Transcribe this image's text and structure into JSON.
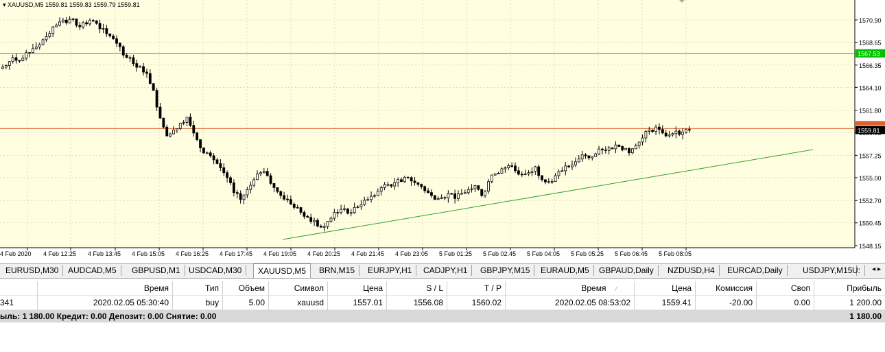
{
  "chart_header": {
    "symbol": "XAUUSD,M5",
    "ohlc": "1559.81 1559.83 1559.79 1559.81"
  },
  "price_labels": [
    "1570.90",
    "1568.65",
    "1566.35",
    "1564.10",
    "1561.80",
    "1559.55",
    "1557.25",
    "1555.00",
    "1552.70",
    "1550.45",
    "1548.15"
  ],
  "hline_green_label": "1567.53",
  "current_price_label": "1559.81",
  "time_labels": [
    "4 Feb 2020",
    "4 Feb 12:25",
    "4 Feb 13:45",
    "4 Feb 15:05",
    "4 Feb 16:25",
    "4 Feb 17:45",
    "4 Feb 19:05",
    "4 Feb 20:25",
    "4 Feb 21:45",
    "4 Feb 23:05",
    "5 Feb 01:25",
    "5 Feb 02:45",
    "5 Feb 04:05",
    "5 Feb 05:25",
    "5 Feb 06:45",
    "5 Feb 08:05"
  ],
  "colors": {
    "bg": "#fffee0",
    "grid": "#c8c8a0",
    "green_line": "#00c000",
    "trend_line": "#30a030",
    "orange_line": "#e06030",
    "candle": "#000000"
  },
  "close_path": [
    1566.3,
    1567.1,
    1566.8,
    1567.6,
    1568.0,
    1568.4,
    1569.2,
    1570.2,
    1570.7,
    1570.6,
    1571.0,
    1570.2,
    1570.5,
    1570.8,
    1570.0,
    1569.5,
    1569.0,
    1568.2,
    1567.1,
    1566.5,
    1566.2,
    1565.5,
    1563.8,
    1561.0,
    1559.2,
    1559.8,
    1560.5,
    1561.1,
    1559.5,
    1558.0,
    1557.5,
    1556.8,
    1556.0,
    1555.0,
    1553.5,
    1552.8,
    1553.8,
    1554.8,
    1555.5,
    1555.2,
    1554.0,
    1553.2,
    1552.8,
    1552.0,
    1551.5,
    1551.0,
    1550.7,
    1550.0,
    1550.6,
    1551.5,
    1551.8,
    1551.4,
    1552.0,
    1552.3,
    1552.8,
    1553.2,
    1554.0,
    1554.3,
    1554.5,
    1554.6,
    1555.0,
    1554.5,
    1554.1,
    1553.5,
    1552.8,
    1553.0,
    1553.4,
    1552.9,
    1553.4,
    1553.8,
    1554.2,
    1553.2,
    1554.6,
    1555.4,
    1555.9,
    1556.2,
    1555.7,
    1555.3,
    1555.5,
    1556.1,
    1554.8,
    1554.6,
    1555.2,
    1555.7,
    1556.1,
    1556.6,
    1557.3,
    1557.0,
    1557.4,
    1557.8,
    1558.0,
    1558.3,
    1557.8,
    1557.5,
    1558.2,
    1559.0,
    1559.8,
    1560.1,
    1559.5,
    1559.3,
    1559.7,
    1559.6,
    1559.8
  ]
}
